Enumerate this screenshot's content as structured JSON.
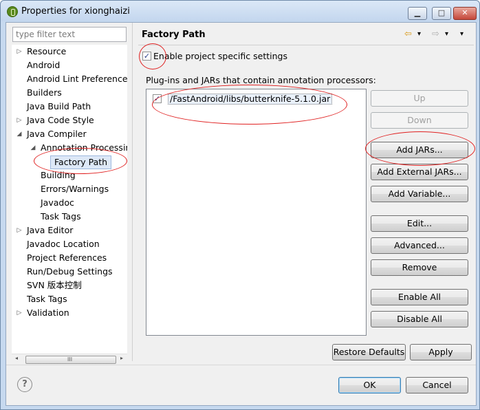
{
  "window": {
    "title": "Properties for xionghaizi",
    "controls": {
      "minimize": "▁",
      "maximize": "□",
      "close": "✕"
    }
  },
  "sidebar": {
    "filter_placeholder": "type filter text",
    "items": [
      {
        "label": "Resource",
        "arrow": "▷"
      },
      {
        "label": "Android"
      },
      {
        "label": "Android Lint Preferences"
      },
      {
        "label": "Builders"
      },
      {
        "label": "Java Build Path"
      },
      {
        "label": "Java Code Style",
        "arrow": "▷"
      },
      {
        "label": "Java Compiler",
        "arrow": "◢"
      },
      {
        "label": "Annotation Processin",
        "arrow": "◢"
      },
      {
        "label": "Factory Path",
        "selected": true
      },
      {
        "label": "Building"
      },
      {
        "label": "Errors/Warnings"
      },
      {
        "label": "Javadoc"
      },
      {
        "label": "Task Tags"
      },
      {
        "label": "Java Editor",
        "arrow": "▷"
      },
      {
        "label": "Javadoc Location"
      },
      {
        "label": "Project References"
      },
      {
        "label": "Run/Debug Settings"
      },
      {
        "label": "SVN 版本控制"
      },
      {
        "label": "Task Tags"
      },
      {
        "label": "Validation",
        "arrow": "▷"
      }
    ],
    "scrollbar": {
      "left": "◂",
      "grip": "III",
      "right": "▸"
    }
  },
  "page": {
    "title": "Factory Path",
    "nav": {
      "back": "⇦",
      "back_menu": "▾",
      "forward": "⇨",
      "forward_menu": "▾",
      "view_menu": "▾"
    },
    "enable_label": "Enable project specific settings",
    "enable_checked": "✓",
    "list_label": "Plug-ins and JARs that contain annotation processors:",
    "entries": [
      {
        "label": "/FastAndroid/libs/butterknife-5.1.0.jar",
        "check": "✓"
      }
    ],
    "buttons": {
      "up": "Up",
      "down": "Down",
      "add_jars": "Add JARs...",
      "add_external_jars": "Add External JARs...",
      "add_variable": "Add Variable...",
      "edit": "Edit...",
      "advanced": "Advanced...",
      "remove": "Remove",
      "enable_all": "Enable All",
      "disable_all": "Disable All"
    },
    "restore_defaults": "Restore Defaults",
    "apply": "Apply"
  },
  "footer": {
    "help": "?",
    "ok": "OK",
    "cancel": "Cancel"
  },
  "colors": {
    "annotation": "#e02020",
    "selection": "#dde8f7",
    "title_bar": "#c6d9ef"
  }
}
